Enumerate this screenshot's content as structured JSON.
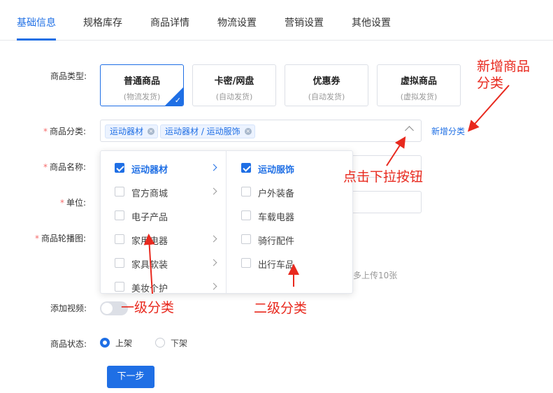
{
  "tabs": [
    "基础信息",
    "规格库存",
    "商品详情",
    "物流设置",
    "营销设置",
    "其他设置"
  ],
  "labels": {
    "type": "商品类型:",
    "category": "商品分类:",
    "name": "商品名称:",
    "unit": "单位:",
    "carousel": "商品轮播图:",
    "video": "添加视频:",
    "status": "商品状态:",
    "required_mark": "*"
  },
  "type_cards": [
    {
      "title": "普通商品",
      "sub": "(物流发货)",
      "selected": true
    },
    {
      "title": "卡密/网盘",
      "sub": "(自动发货)",
      "selected": false
    },
    {
      "title": "优惠券",
      "sub": "(自动发货)",
      "selected": false
    },
    {
      "title": "虚拟商品",
      "sub": "(虚拟发货)",
      "selected": false
    }
  ],
  "category_tags": [
    "运动器材",
    "运动器材 / 运动服饰"
  ],
  "tag_close": "×",
  "new_category_link": "新增分类",
  "cascader": {
    "level1": [
      {
        "label": "运动器材",
        "checked": true,
        "active": true
      },
      {
        "label": "官方商城",
        "checked": false
      },
      {
        "label": "电子产品",
        "checked": false
      },
      {
        "label": "家用电器",
        "checked": false
      },
      {
        "label": "家具软装",
        "checked": false
      },
      {
        "label": "美妆个护",
        "checked": false
      }
    ],
    "level2": [
      {
        "label": "运动服饰",
        "checked": true
      },
      {
        "label": "户外装备",
        "checked": false
      },
      {
        "label": "车载电器",
        "checked": false
      },
      {
        "label": "骑行配件",
        "checked": false
      },
      {
        "label": "出行车品",
        "checked": false
      }
    ]
  },
  "upload_hint": "多上传10张",
  "status_options": [
    {
      "label": "上架",
      "checked": true
    },
    {
      "label": "下架",
      "checked": false
    }
  ],
  "next_button": "下一步",
  "annotations": {
    "new_category": "新增商品\n分类",
    "dropdown_button": "点击下拉按钮",
    "level1": "一级分类",
    "level2": "二级分类"
  },
  "colors": {
    "accent": "#1f6fe5",
    "annotation": "#e8291e",
    "required": "#f56c6c"
  }
}
